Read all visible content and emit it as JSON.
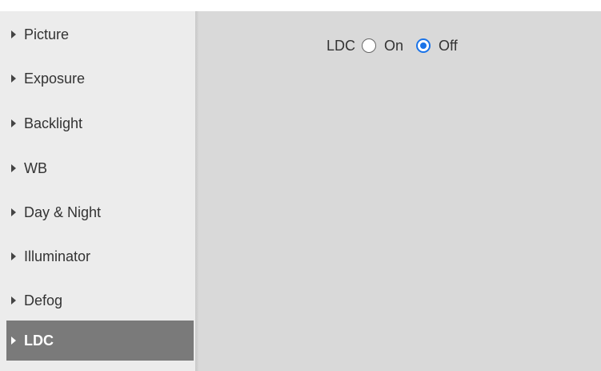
{
  "sidebar": {
    "items": [
      {
        "label": "Picture"
      },
      {
        "label": "Exposure"
      },
      {
        "label": "Backlight"
      },
      {
        "label": "WB"
      },
      {
        "label": "Day & Night"
      },
      {
        "label": "Illuminator"
      },
      {
        "label": "Defog"
      },
      {
        "label": "LDC"
      }
    ],
    "active_label": "LDC"
  },
  "ldc": {
    "label": "LDC",
    "options": [
      {
        "label": "On",
        "checked": false
      },
      {
        "label": "Off",
        "checked": true
      }
    ]
  },
  "colors": {
    "active_item_bg": "#7a7a7a",
    "content_bg": "#d9d9d9",
    "sidebar_bg": "#ececec",
    "radio_accent": "#1a73e8"
  },
  "icons": {
    "nav_arrow": "caret-right-icon"
  }
}
